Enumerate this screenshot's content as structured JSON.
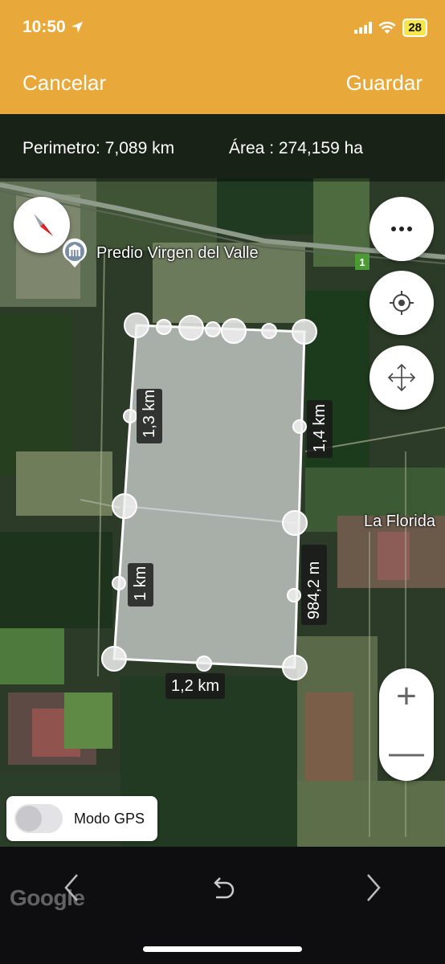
{
  "status_bar": {
    "time": "10:50",
    "battery": "28",
    "location_icon": "location-arrow-icon"
  },
  "header": {
    "cancel_label": "Cancelar",
    "save_label": "Guardar",
    "accent_color": "#e8a93a"
  },
  "metrics": {
    "perimeter": "Perimetro: 7,089 km",
    "area": "Área : 274,159 ha"
  },
  "map": {
    "place_name": "Predio Virgen del Valle",
    "town_name": "La Florida",
    "road_number": "1",
    "attribution": "Google",
    "segment_labels": {
      "left_top": "1,3 km",
      "right_top": "1,4 km",
      "left_bottom": "1 km",
      "right_bottom": "984,2 m",
      "bottom": "1,2 km"
    }
  },
  "controls": {
    "compass_icon": "compass-icon",
    "more_icon": "more-options-icon",
    "gps_icon": "locate-icon",
    "move_icon": "move-icon",
    "zoom_in": "+",
    "zoom_out": "—"
  },
  "gps_mode": {
    "label": "Modo GPS",
    "enabled": false
  },
  "toolbar": {
    "prev_icon": "chevron-left-icon",
    "undo_icon": "undo-icon",
    "next_icon": "chevron-right-icon"
  }
}
